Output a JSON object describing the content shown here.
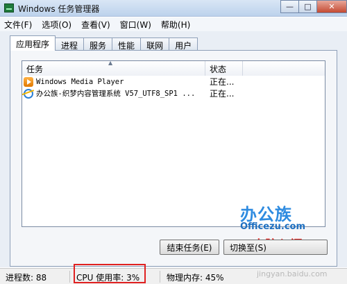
{
  "window": {
    "title": "Windows 任务管理器"
  },
  "menu": [
    "文件(F)",
    "选项(O)",
    "查看(V)",
    "窗口(W)",
    "帮助(H)"
  ],
  "tabs": [
    "应用程序",
    "进程",
    "服务",
    "性能",
    "联网",
    "用户"
  ],
  "list": {
    "columns": {
      "task": "任务",
      "status": "状态"
    },
    "rows": [
      {
        "name": "Windows Media Player",
        "status": "正在...",
        "icon": "media-player-icon"
      },
      {
        "name": "办公族-织梦内容管理系统 V57_UTF8_SP1 ...",
        "status": "正在...",
        "icon": "ie-browser-icon"
      }
    ]
  },
  "buttons": {
    "end_task": "结束任务(E)",
    "switch": "切换至(S)"
  },
  "watermark": {
    "brand": "办公族",
    "url": "Officezu.com",
    "tag": "电脑入门",
    "site": "jingyan.baidu.com"
  },
  "status": {
    "processes": "进程数: 88",
    "cpu": "CPU 使用率: 3%",
    "memory": "物理内存: 45%"
  },
  "colors": {
    "highlight": "#e02020",
    "brand_blue": "#2e8be0"
  }
}
